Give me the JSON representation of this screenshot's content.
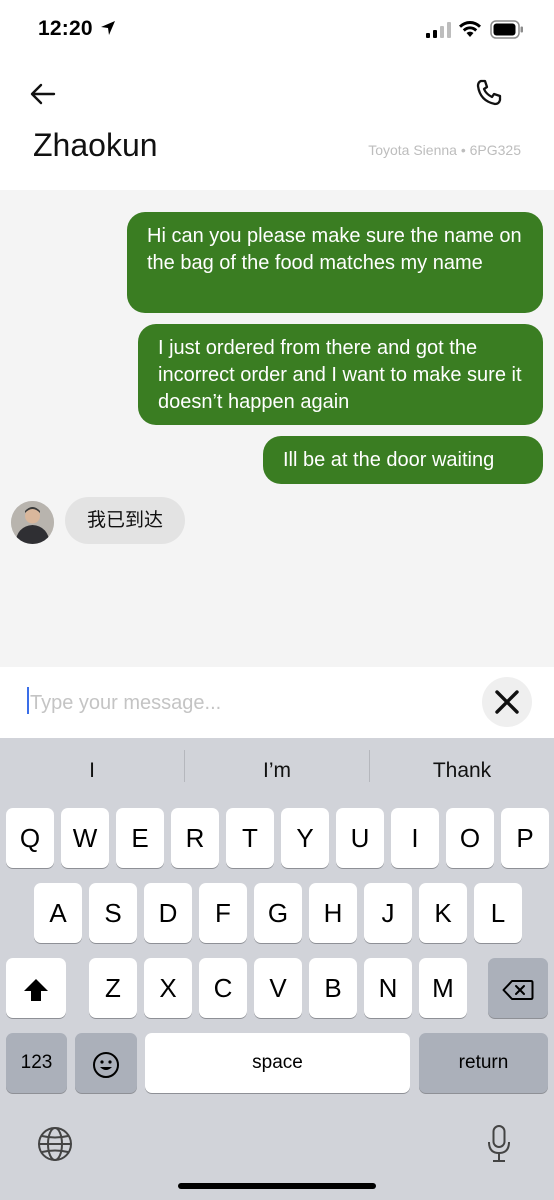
{
  "status_bar": {
    "time": "12:20"
  },
  "header": {
    "contact_name": "Zhaokun",
    "vehicle": "Toyota Sienna • 6PG325"
  },
  "messages": [
    {
      "direction": "outgoing",
      "text": "Hi can you please make sure the name on the bag of the food matches my name"
    },
    {
      "direction": "outgoing",
      "text": "I just ordered from there and got the incorrect order and I want to make sure it doesn’t happen again"
    },
    {
      "direction": "outgoing",
      "text": "Ill be at the door waiting"
    },
    {
      "direction": "incoming",
      "text": "我已到达"
    }
  ],
  "input": {
    "placeholder": "Type your message...",
    "value": ""
  },
  "keyboard": {
    "suggestions": [
      "I",
      "I’m",
      "Thank"
    ],
    "row1": [
      "Q",
      "W",
      "E",
      "R",
      "T",
      "Y",
      "U",
      "I",
      "O",
      "P"
    ],
    "row2": [
      "A",
      "S",
      "D",
      "F",
      "G",
      "H",
      "J",
      "K",
      "L"
    ],
    "row3": [
      "Z",
      "X",
      "C",
      "V",
      "B",
      "N",
      "M"
    ],
    "numbers_label": "123",
    "space_label": "space",
    "return_label": "return"
  },
  "colors": {
    "outgoing_bubble": "#3a7d22",
    "incoming_bubble": "#e3e3e3",
    "keyboard_bg": "#d1d3d9"
  },
  "icons": {
    "back": "arrow-left-icon",
    "call": "phone-icon",
    "close": "close-icon",
    "shift": "shift-icon",
    "delete": "backspace-icon",
    "emoji": "emoji-icon",
    "globe": "globe-icon",
    "dictation": "microphone-icon"
  }
}
